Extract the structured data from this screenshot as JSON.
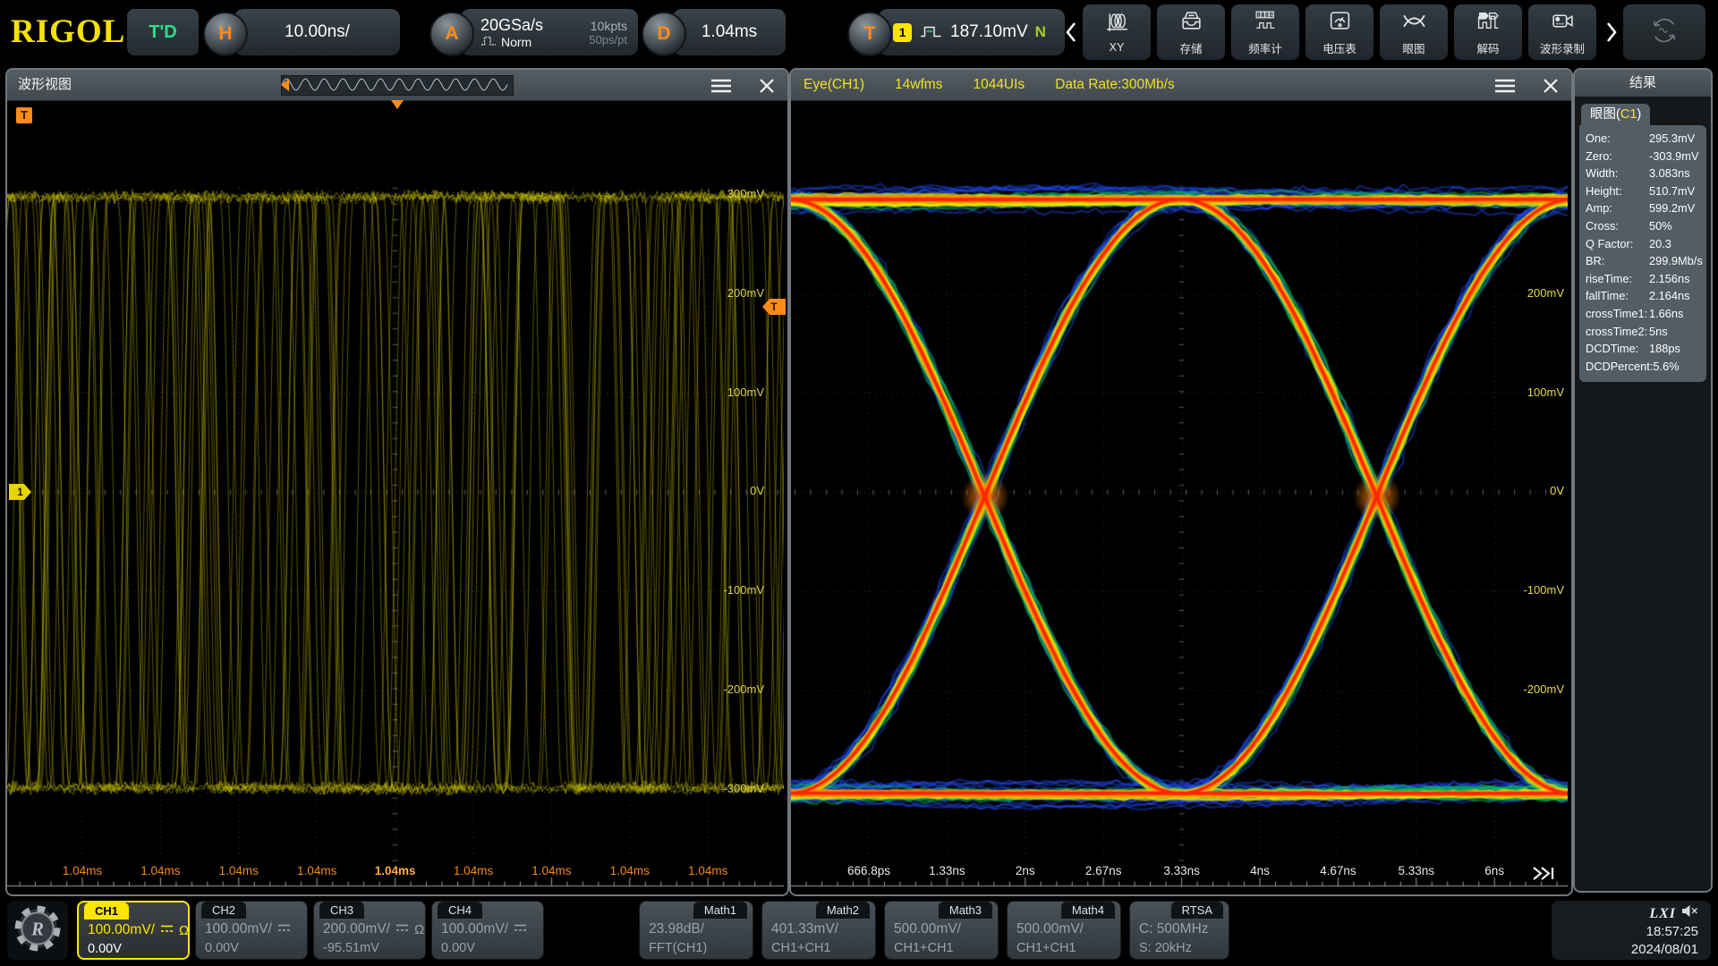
{
  "top_bar": {
    "logo": "RIGOL",
    "trigger_status": "T'D",
    "horizontal": {
      "knob": "H",
      "scale": "10.00ns/"
    },
    "acquire": {
      "knob": "A",
      "sample_rate": "20GSa/s",
      "mode": "Norm",
      "mem_depth": "10kpts",
      "interval": "50ps/pt"
    },
    "delay": {
      "knob": "D",
      "value": "1.04ms"
    },
    "trigger": {
      "knob": "T",
      "source": "1",
      "level": "187.10mV",
      "slope": "N"
    },
    "toolbar": [
      {
        "label": "XY",
        "icon": "xy"
      },
      {
        "label": "存储",
        "icon": "storage"
      },
      {
        "label": "频率计",
        "icon": "counter"
      },
      {
        "label": "电压表",
        "icon": "voltmeter"
      },
      {
        "label": "眼图",
        "icon": "eye"
      },
      {
        "label": "解码",
        "icon": "decode"
      },
      {
        "label": "波形录制",
        "icon": "record"
      }
    ]
  },
  "waveform_panel": {
    "title": "波形视图",
    "y_labels": [
      "300mV",
      "200mV",
      "100mV",
      "0V",
      "-100mV",
      "-200mV",
      "-300mV"
    ],
    "x_labels": [
      "1.04ms",
      "1.04ms",
      "1.04ms",
      "1.04ms",
      "1.04ms",
      "1.04ms",
      "1.04ms",
      "1.04ms",
      "1.04ms"
    ],
    "trigger_corner": "T",
    "channel_marker": "1",
    "trigger_level_marker": "T"
  },
  "eye_panel": {
    "title": "Eye(CH1)",
    "wfms": "14wfms",
    "uis": "1044UIs",
    "data_rate": "Data Rate:300Mb/s",
    "y_labels": [
      "200mV",
      "100mV",
      "0V",
      "-100mV",
      "-200mV"
    ],
    "x_labels": [
      "666.8ps",
      "1.33ns",
      "2ns",
      "2.67ns",
      "3.33ns",
      "4ns",
      "4.67ns",
      "5.33ns",
      "6ns"
    ]
  },
  "results_panel": {
    "title": "结果",
    "tab_prefix": "眼图(",
    "tab_channel": "C1",
    "tab_suffix": ")",
    "measurements": [
      {
        "label": "One:",
        "value": "295.3mV"
      },
      {
        "label": "Zero:",
        "value": "-303.9mV"
      },
      {
        "label": "Width:",
        "value": "3.083ns"
      },
      {
        "label": "Height:",
        "value": "510.7mV"
      },
      {
        "label": "Amp:",
        "value": "599.2mV"
      },
      {
        "label": "Cross:",
        "value": "50%"
      },
      {
        "label": "Q Factor:",
        "value": "20.3"
      },
      {
        "label": "BR:",
        "value": "299.9Mb/s"
      },
      {
        "label": "riseTime:",
        "value": "2.156ns"
      },
      {
        "label": "fallTime:",
        "value": "2.164ns"
      },
      {
        "label": "crossTime1:",
        "value": "1.66ns"
      },
      {
        "label": "crossTime2:",
        "value": "5ns"
      },
      {
        "label": "DCDTime:",
        "value": "188ps"
      },
      {
        "label": "DCDPercent:",
        "value": "5.6%"
      }
    ]
  },
  "bottom_bar": {
    "channels": [
      {
        "name": "CH1",
        "scale": "100.00mV/",
        "offset": "0.00V",
        "impedance": "Ω",
        "active": true
      },
      {
        "name": "CH2",
        "scale": "100.00mV/",
        "offset": "0.00V",
        "impedance": "",
        "active": false
      },
      {
        "name": "CH3",
        "scale": "200.00mV/",
        "offset": "-95.51mV",
        "impedance": "Ω",
        "active": false
      },
      {
        "name": "CH4",
        "scale": "100.00mV/",
        "offset": "0.00V",
        "impedance": "",
        "active": false
      }
    ],
    "maths": [
      {
        "name": "Math1",
        "scale": "23.98dB/",
        "source": "FFT(CH1)"
      },
      {
        "name": "Math2",
        "scale": "401.33mV/",
        "source": "CH1+CH1"
      },
      {
        "name": "Math3",
        "scale": "500.00mV/",
        "source": "CH1+CH1"
      },
      {
        "name": "Math4",
        "scale": "500.00mV/",
        "source": "CH1+CH1"
      }
    ],
    "rtsa": {
      "name": "RTSA",
      "center": "C: 500MHz",
      "span": "S: 20kHz"
    },
    "status": {
      "lxi": "LXI",
      "time": "18:57:25",
      "date": "2024/08/01"
    }
  },
  "colors": {
    "channel1": "#ffe600",
    "trace_yellow": "#d6d000",
    "accent_orange": "#ff8c1a",
    "trigger_green": "#2be08a",
    "eye_header_yellow": "#f0e11c",
    "heat_palette": [
      "#2250ff",
      "#00c850",
      "#f2e600",
      "#ff8c00",
      "#ff2800"
    ]
  },
  "chart_data": [
    {
      "type": "line",
      "title": "波形视图 (CH1 persistence waveform)",
      "channel": "CH1",
      "signal": "random NRZ data stream, 300Mb/s, persistence display",
      "volts_per_div": "100.00mV",
      "time_per_div": "10.00ns",
      "high_level_mV": 300,
      "low_level_mV": -300,
      "trigger_level_mV": 187.1,
      "ylim_mV": [
        -400,
        400
      ],
      "y_ticks": [
        "300mV",
        "200mV",
        "100mV",
        "0V",
        "-100mV",
        "-200mV",
        "-300mV"
      ],
      "x_ticks": [
        "1.04ms",
        "1.04ms",
        "1.04ms",
        "1.04ms",
        "1.04ms",
        "1.04ms",
        "1.04ms",
        "1.04ms",
        "1.04ms"
      ],
      "grid": "10x8 divisions, dotted",
      "line_color": "#d6d000"
    },
    {
      "type": "heatmap",
      "title": "Eye(CH1)",
      "waveforms": 14,
      "unit_intervals": 1044,
      "data_rate_Mbps": 300,
      "one_level_mV": 295.3,
      "zero_level_mV": -303.9,
      "eye_width_ns": 3.083,
      "eye_height_mV": 510.7,
      "amplitude_mV": 599.2,
      "crossing_percent": 50,
      "q_factor": 20.3,
      "bit_rate": "299.9Mb/s",
      "rise_time_ns": 2.156,
      "fall_time_ns": 2.164,
      "cross_time1_ns": 1.66,
      "cross_time2_ns": 5,
      "dcd_time_ps": 188,
      "dcd_percent": 5.6,
      "x_ticks": [
        "666.8ps",
        "1.33ns",
        "2ns",
        "2.67ns",
        "3.33ns",
        "4ns",
        "4.67ns",
        "5.33ns",
        "6ns"
      ],
      "y_ticks": [
        "200mV",
        "100mV",
        "0V",
        "-100mV",
        "-200mV"
      ],
      "ylim_mV": [
        -400,
        400
      ],
      "palette_low_to_high_density": [
        "#2250ff",
        "#00c850",
        "#f2e600",
        "#ff8c00",
        "#ff2800"
      ]
    }
  ]
}
